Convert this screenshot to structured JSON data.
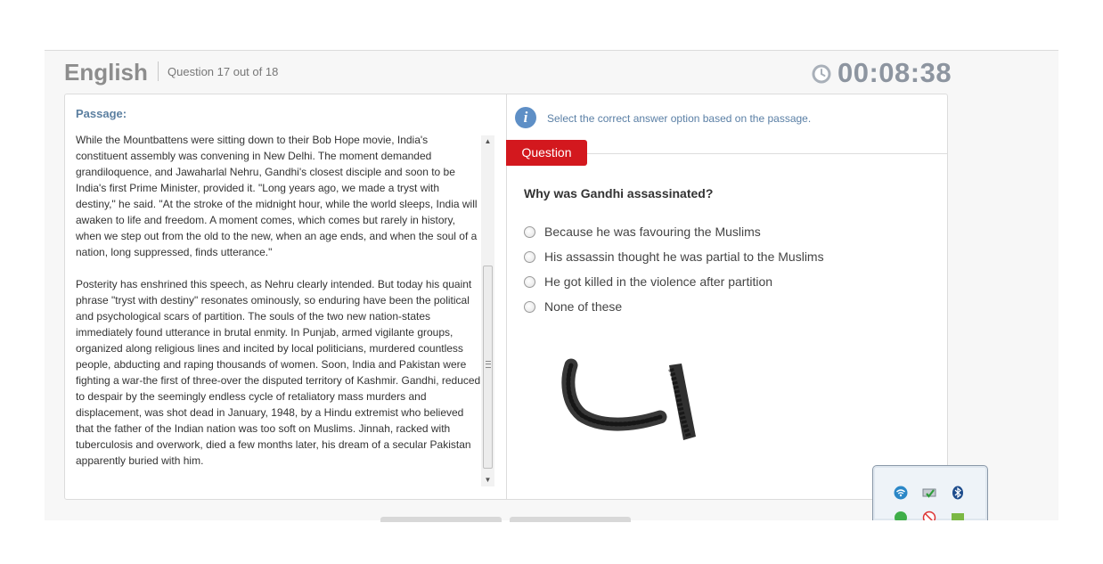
{
  "header": {
    "subject": "English",
    "question_counter": "Question 17 out of 18",
    "timer": "00:08:38",
    "timer_icon": "clock-icon"
  },
  "passage": {
    "title": "Passage:",
    "paragraphs": [
      "While the Mountbattens were sitting down to their Bob Hope movie, India's constituent assembly was convening in New Delhi. The moment demanded grandiloquence, and Jawaharlal Nehru, Gandhi's closest disciple and soon to be India's first Prime Minister, provided it. \"Long years ago, we made a tryst with destiny,\" he said. \"At the stroke of the midnight hour, while the world sleeps, India will awaken to life and freedom. A moment comes, which comes but rarely in history, when we step out from the old to the new, when an age ends, and when the soul of a nation, long suppressed, finds utterance.\"",
      "Posterity has enshrined this speech, as Nehru clearly intended. But today his quaint phrase \"tryst with destiny\" resonates ominously, so enduring have been the political and psychological scars of partition. The souls of the two new nation-states immediately found utterance in brutal enmity. In Punjab, armed vigilante groups, organized along religious lines and incited by local politicians, murdered countless people, abducting and raping thousands of women. Soon, India and Pakistan were fighting a war-the first of three-over the disputed territory of Kashmir. Gandhi, reduced to despair by the seemingly endless cycle of retaliatory mass murders and displacement, was shot dead in January, 1948, by a Hindu extremist who believed that the father of the Indian nation was too soft on Muslims. Jinnah, racked with tuberculosis and overwork, died a few months later, his dream of a secular Pakistan apparently buried with him."
    ]
  },
  "instruction": "Select the correct answer option based on the passage.",
  "question_tab": "Question",
  "question": {
    "text": "Why was Gandhi assassinated?",
    "options": [
      "Because he was favouring the Muslims",
      "His assassin thought he was partial to the Muslims",
      "He got killed in the violence after partition",
      "None of these"
    ]
  },
  "colors": {
    "accent_red": "#d3181e",
    "link_blue": "#5a7fa5",
    "timer_gray": "#8d95a0"
  },
  "tray_icons": [
    "wifi-icon",
    "network-check-icon",
    "bluetooth-icon",
    "green-status-icon",
    "blocked-icon",
    "green-square-icon"
  ]
}
